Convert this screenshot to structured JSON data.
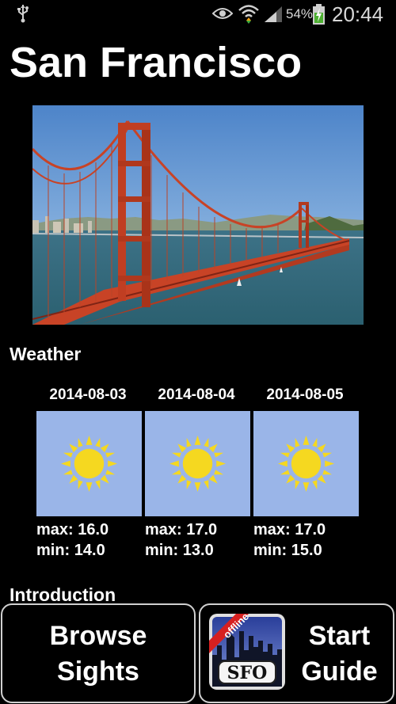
{
  "status_bar": {
    "usb_icon": "usb-icon",
    "eye_icon": "eye-icon",
    "wifi_icon": "wifi-icon",
    "signal_icon": "signal-icon",
    "battery_percent": "54%",
    "battery_icon": "battery-charging-icon",
    "time": "20:44"
  },
  "page": {
    "title": "San Francisco",
    "hero_image": "golden-gate-bridge-photo"
  },
  "weather": {
    "heading": "Weather",
    "days": [
      {
        "date": "2014-08-03",
        "icon": "sun-icon",
        "max": "max: 16.0",
        "min": "min: 14.0"
      },
      {
        "date": "2014-08-04",
        "icon": "sun-icon",
        "max": "max: 17.0",
        "min": "min: 13.0"
      },
      {
        "date": "2014-08-05",
        "icon": "sun-icon",
        "max": "max: 17.0",
        "min": "min: 15.0"
      }
    ]
  },
  "introduction": {
    "heading": "Introduction"
  },
  "buttons": {
    "browse_label": "Browse\nSights",
    "guide_label": "Start\nGuide",
    "badge_ribbon": "offline",
    "badge_text": "SFO"
  },
  "colors": {
    "background": "#000000",
    "weather_tile": "#9ab5e8",
    "sun": "#f5d820",
    "badge_ribbon": "#d62020"
  }
}
